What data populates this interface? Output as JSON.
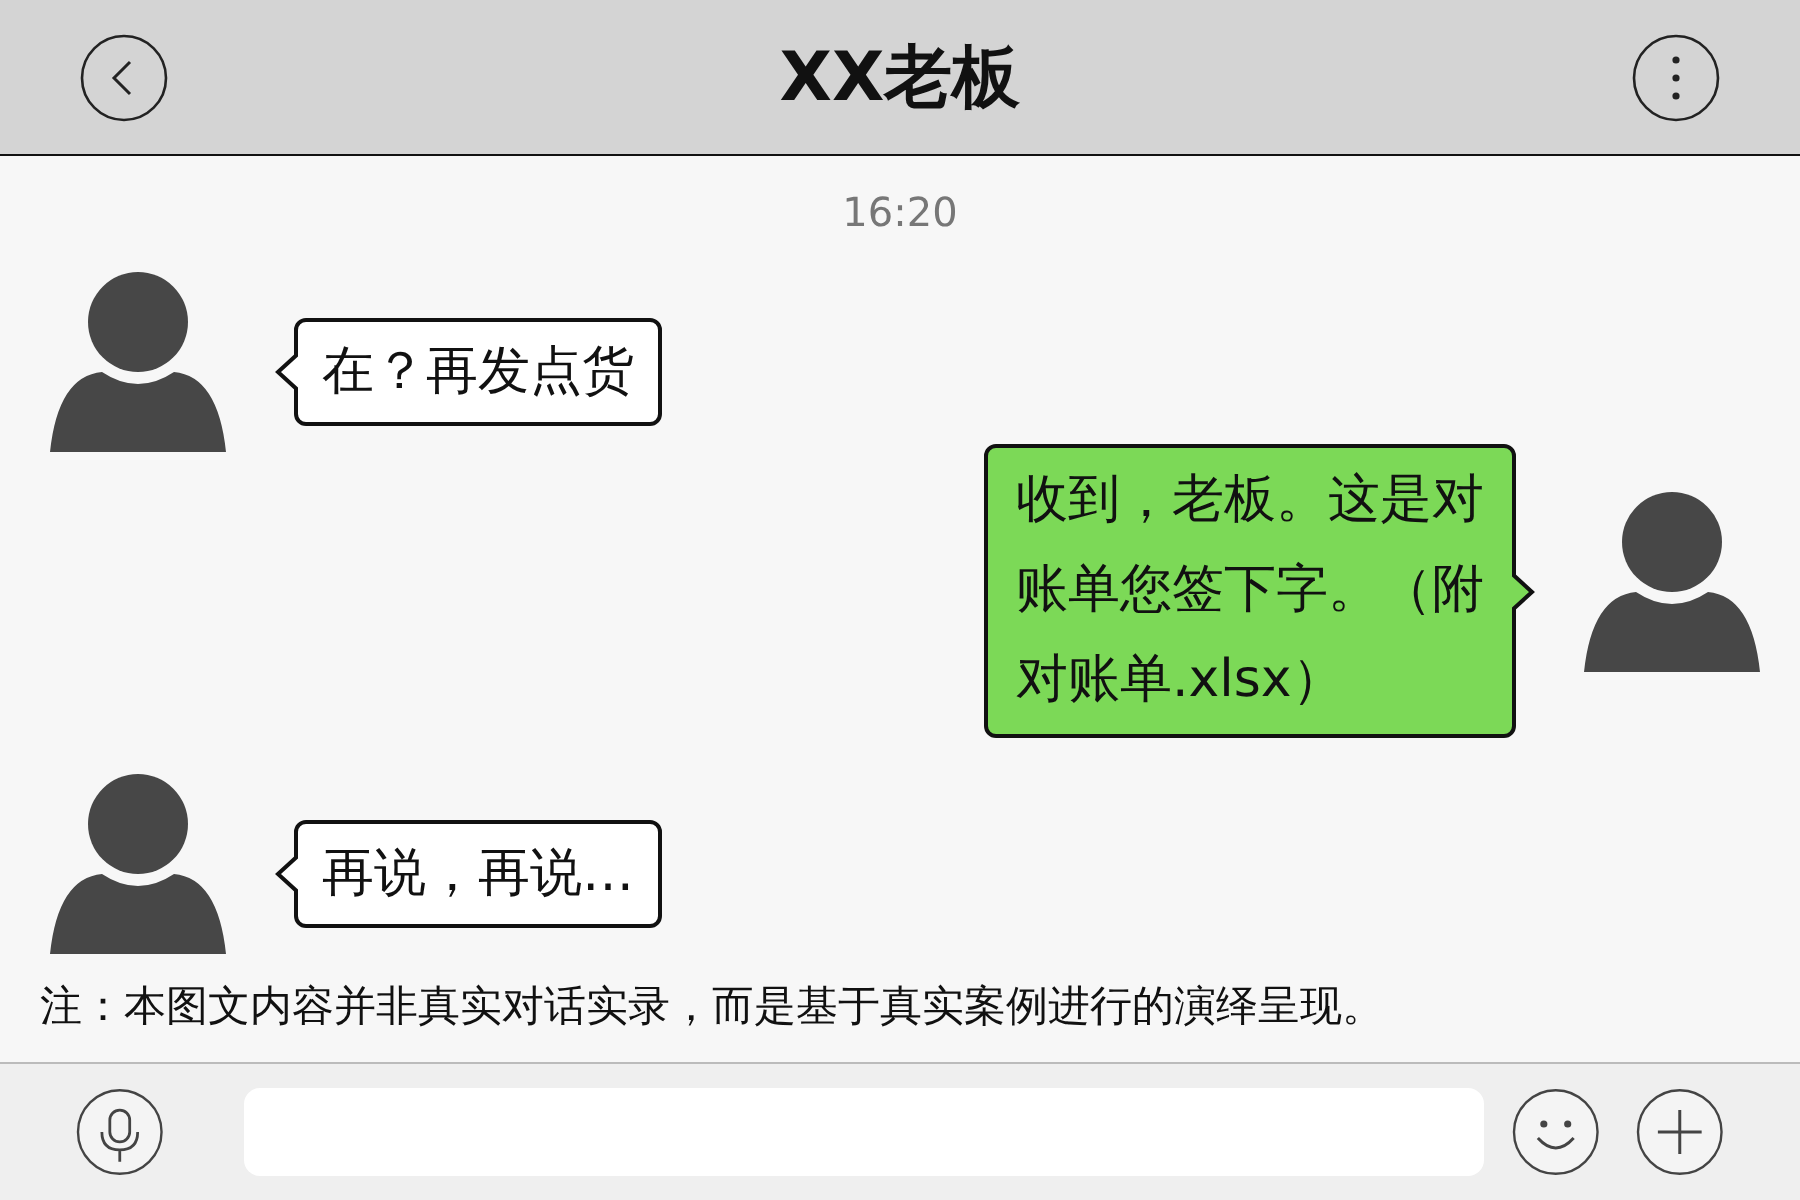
{
  "header": {
    "title": "XX老板"
  },
  "time": "16:20",
  "messages": [
    {
      "kind": "received",
      "text": "在？再发点货"
    },
    {
      "kind": "sent",
      "text": "收到，老板。这是对账单您签下字。（附对账单.xlsx）"
    },
    {
      "kind": "received",
      "text": "再说，再说…"
    }
  ],
  "note": "注：本图文内容并非真实对话实录，而是基于真实案例进行的演绎呈现。"
}
